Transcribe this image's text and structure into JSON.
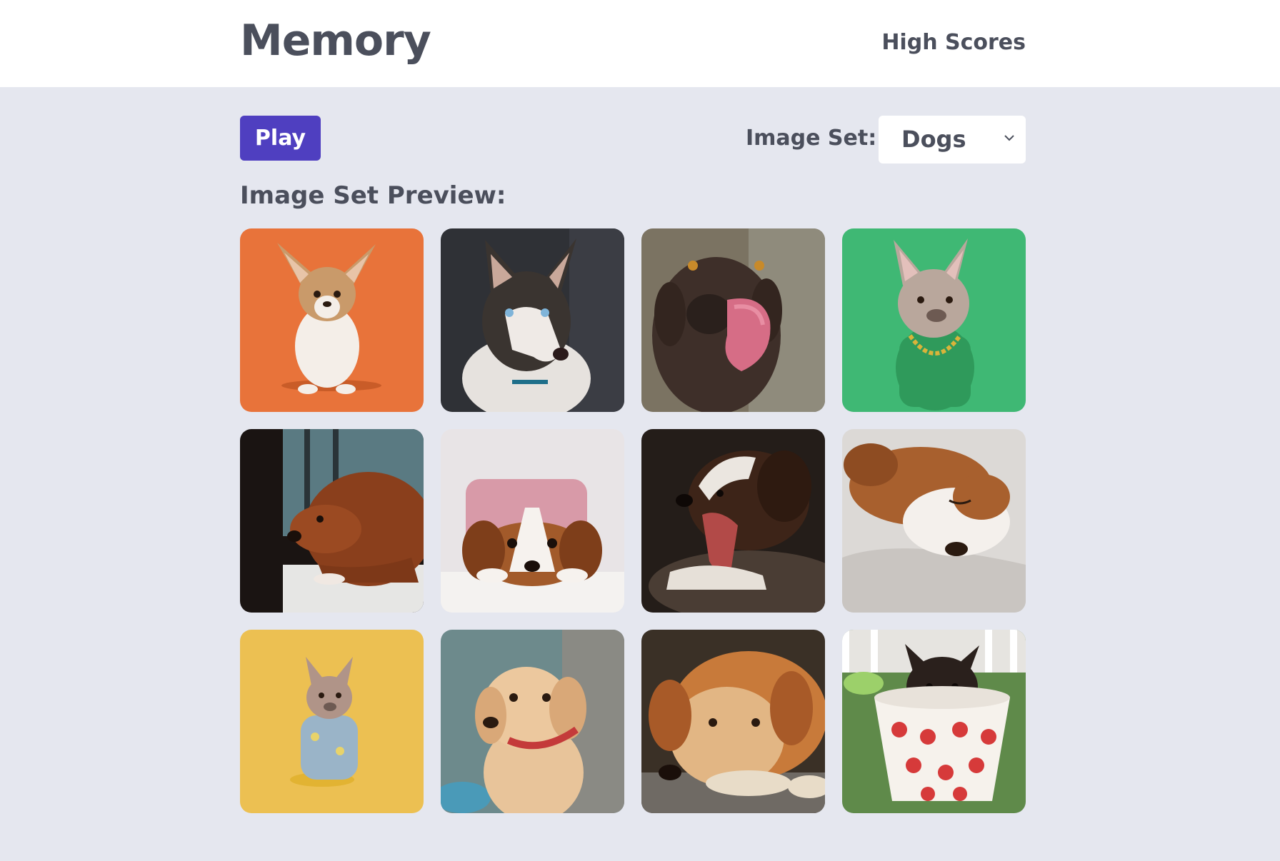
{
  "header": {
    "title": "Memory",
    "high_scores_label": "High Scores"
  },
  "controls": {
    "play_label": "Play",
    "image_set_label": "Image Set:",
    "image_set_selected": "Dogs"
  },
  "preview": {
    "title": "Image Set Preview:",
    "images": [
      {
        "name": "corgi-puppy-orange-image",
        "bg": "#e8733a"
      },
      {
        "name": "husky-image",
        "bg": "#2f3136"
      },
      {
        "name": "labrador-licking-image",
        "bg": "#7b7362"
      },
      {
        "name": "french-bulldog-green-image",
        "bg": "#3fb874"
      },
      {
        "name": "spaniel-window-image",
        "bg": "#1a1412"
      },
      {
        "name": "cavalier-puppy-image",
        "bg": "#e8e4e6"
      },
      {
        "name": "yawning-puppy-image",
        "bg": "#241d19"
      },
      {
        "name": "sleeping-beagle-image",
        "bg": "#dcd9d6"
      },
      {
        "name": "french-bulldog-yellow-image",
        "bg": "#ecc052"
      },
      {
        "name": "golden-puppy-image",
        "bg": "#6d8a8c"
      },
      {
        "name": "golden-retriever-lying-image",
        "bg": "#3a3026"
      },
      {
        "name": "chihuahua-teacup-image",
        "bg": "#5f8a4a"
      }
    ]
  },
  "colors": {
    "accent": "#4f3fc0",
    "background": "#e5e7ef",
    "text": "#4b4f5c"
  }
}
